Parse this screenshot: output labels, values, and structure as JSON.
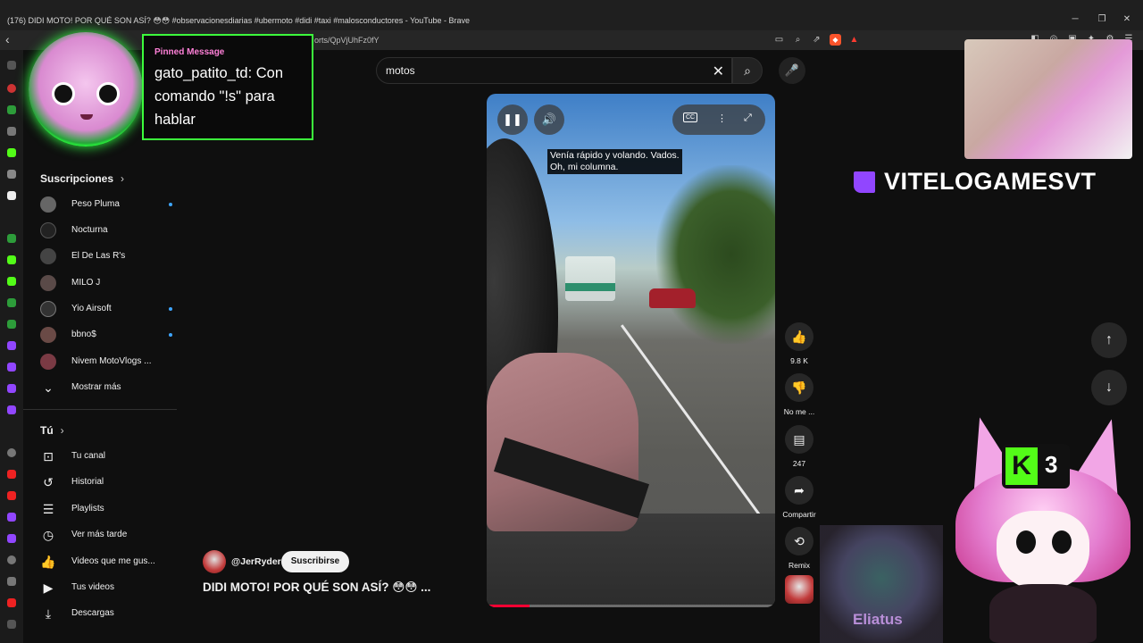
{
  "window": {
    "title": "(176) DIDI MOTO! POR QUÉ SON ASÍ? 😳😳 #observacionesdiarias #ubermoto #didi #taxi #malosconductores - YouTube - Brave",
    "controls": [
      "─",
      "❐",
      "✕"
    ]
  },
  "address_bar": {
    "url": "orts/QpVjUhFz0fY"
  },
  "pinned_overlay": {
    "label": "Pinned Message",
    "text": "gato_patito_td: Con comando \"!s\" para hablar"
  },
  "search": {
    "query": "motos"
  },
  "sidebar": {
    "subscriptions_title": "Suscripciones",
    "subscriptions": [
      {
        "label": "Peso Pluma",
        "live": true
      },
      {
        "label": "Nocturna",
        "live": false
      },
      {
        "label": "El De Las R's",
        "live": false
      },
      {
        "label": "MILO J",
        "live": false
      },
      {
        "label": "Yio Airsoft",
        "live": true
      },
      {
        "label": "bbno$",
        "live": true
      },
      {
        "label": "Nivem MotoVlogs ...",
        "live": false
      }
    ],
    "show_more": "Mostrar más",
    "you_title": "Tú",
    "you_items": [
      {
        "label": "Tu canal",
        "icon": "channel-icon"
      },
      {
        "label": "Historial",
        "icon": "history-icon"
      },
      {
        "label": "Playlists",
        "icon": "playlist-icon"
      },
      {
        "label": "Ver más tarde",
        "icon": "clock-icon"
      },
      {
        "label": "Videos que me gus...",
        "icon": "thumb-up-icon"
      },
      {
        "label": "Tus videos",
        "icon": "video-icon"
      },
      {
        "label": "Descargas",
        "icon": "download-icon"
      }
    ]
  },
  "video": {
    "caption_line1": "Venía rápido y volando. Vados.",
    "caption_line2": "Oh, mi columna.",
    "progress": 0.15,
    "channel": "@JerRyder",
    "subscribe_label": "Suscribirse",
    "title": "DIDI MOTO! POR QUÉ SON ASÍ? 😳😳 ..."
  },
  "actions": {
    "likes": "9.8 K",
    "dislike_label": "No me ...",
    "comments": "247",
    "share_label": "Compartir",
    "remix_label": "Remix"
  },
  "stream_overlay": {
    "twitch_name": "VITELOGAMESVT",
    "kick_count": "3",
    "second_cam_name": "Eliatus"
  },
  "colors": {
    "background": "#0f0f0f",
    "accent_red": "#ff0033",
    "pinned_border": "#3cff3c",
    "pinned_label": "#ff80d8",
    "twitch_purple": "#9146ff",
    "kick_green": "#53fc18",
    "live_dot": "#3ea6ff"
  }
}
